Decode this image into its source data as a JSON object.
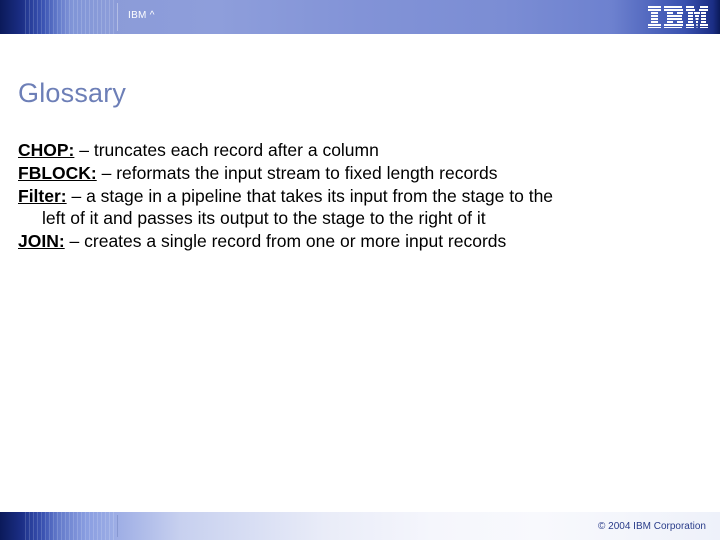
{
  "header": {
    "label": "IBM ^",
    "logo_aria": "IBM"
  },
  "title": "Glossary",
  "entries": [
    {
      "term": "CHOP:",
      "def": " – truncates each record after a column"
    },
    {
      "term": "FBLOCK:",
      "def": " – reformats the input stream to fixed length records"
    },
    {
      "term": "Filter:",
      "def": " – a stage in a pipeline that takes its input from the stage to the",
      "cont": "left of it and passes its output to the stage to the right of it"
    },
    {
      "term": "JOIN:",
      "def": " – creates a single record from one or more input records"
    }
  ],
  "footer": {
    "copyright": "© 2004 IBM Corporation"
  }
}
